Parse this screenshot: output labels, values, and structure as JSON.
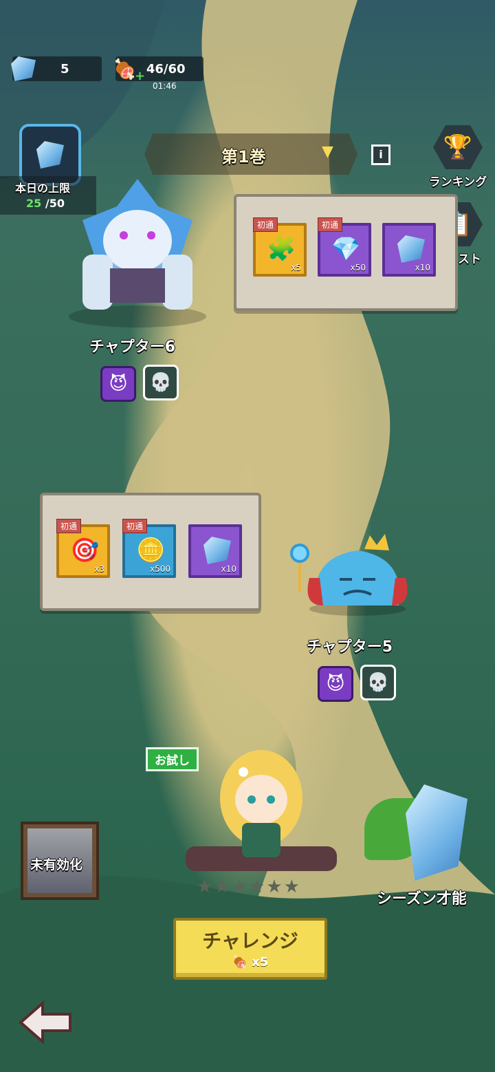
{
  "hud": {
    "gems": "5",
    "stamina": "46/60",
    "stamina_timer": "01:46"
  },
  "daily_limit": {
    "label": "本日の上限",
    "current": "25",
    "max": "/50"
  },
  "volume_selector": {
    "label": "第1巻"
  },
  "side_menu": {
    "ranking_label": "ランキング",
    "quest_label": "クエスト"
  },
  "chapter6": {
    "label": "チャプター6",
    "rewards": [
      {
        "tag": "初通",
        "qty": "x5",
        "icon": "character-puzzle-icon"
      },
      {
        "tag": "初通",
        "qty": "x50",
        "icon": "pink-gem-icon"
      },
      {
        "tag": "",
        "qty": "x10",
        "icon": "crystal-icon"
      }
    ]
  },
  "chapter5": {
    "label": "チャプター5",
    "rewards": [
      {
        "tag": "初通",
        "qty": "x3",
        "icon": "target-icon"
      },
      {
        "tag": "初通",
        "qty": "x500",
        "icon": "gold-coin-icon"
      },
      {
        "tag": "",
        "qty": "x10",
        "icon": "crystal-icon"
      }
    ]
  },
  "trial_badge": "お試し",
  "inactive_label": "未有効化",
  "season_talent_label": "シーズン才能",
  "challenge": {
    "label": "チャレンジ",
    "cost": "x5"
  },
  "hero_stars": 0,
  "colors": {
    "accent_yellow": "#f5dc57",
    "badge_green": "#2fb043",
    "current_limit_green": "#6fe36a"
  }
}
